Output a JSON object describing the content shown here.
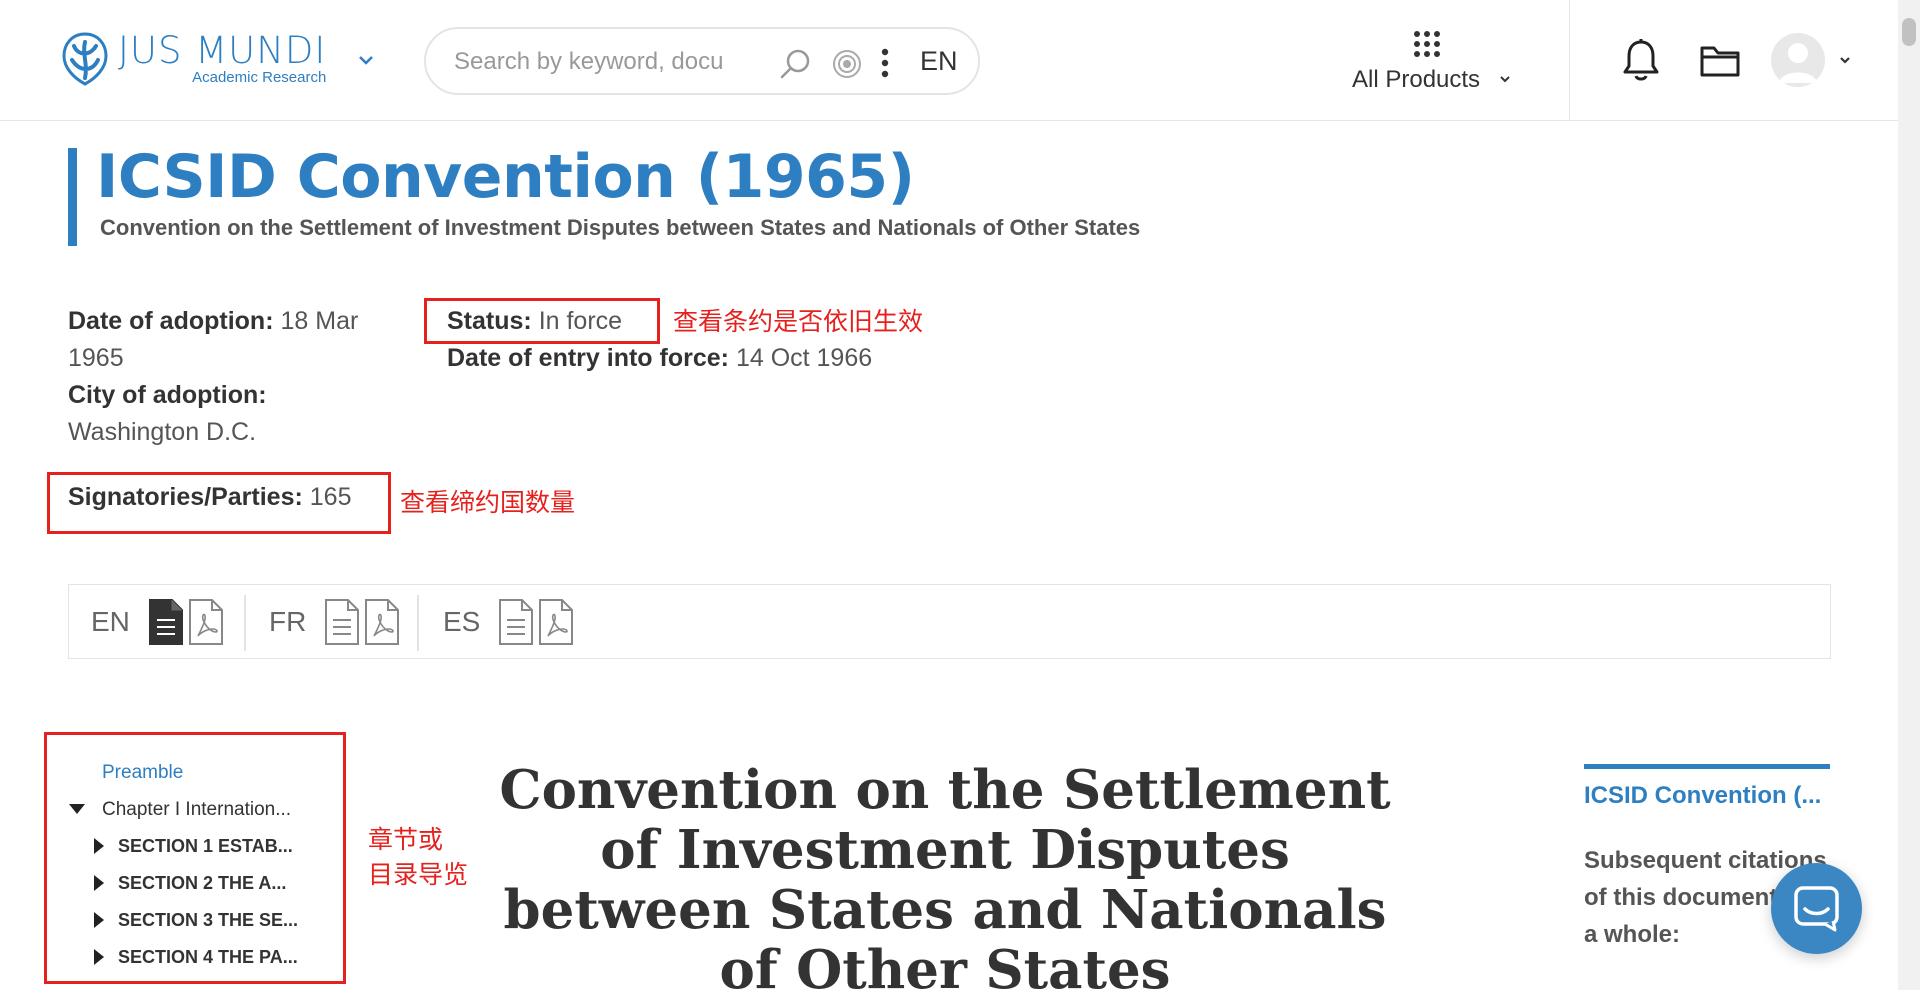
{
  "header": {
    "logo": {
      "name": "JUS MUNDI",
      "subtitle": "Academic Research"
    },
    "search": {
      "placeholder": "Search by keyword, docu",
      "language": "EN"
    },
    "products_label": "All Products"
  },
  "page": {
    "title": "ICSID Convention (1965)",
    "subtitle": "Convention on the Settlement of Investment Disputes between States and Nationals of Other States"
  },
  "metadata": {
    "date_of_adoption": {
      "label": "Date of adoption:",
      "value": "18 Mar 1965"
    },
    "city_of_adoption": {
      "label": "City of adoption:",
      "value": "Washington D.C."
    },
    "status": {
      "label": "Status:",
      "value": "In force"
    },
    "date_of_entry": {
      "label": "Date of entry into force:",
      "value": "14 Oct 1966"
    },
    "signatories": {
      "label": "Signatories/Parties:",
      "value": "165"
    }
  },
  "annotations": {
    "status_note": "查看条约是否依旧生效",
    "parties_note": "查看缔约国数量",
    "toc_note_line1": "章节或",
    "toc_note_line2": "目录导览"
  },
  "documents": [
    {
      "lang": "EN",
      "active": true
    },
    {
      "lang": "FR",
      "active": false
    },
    {
      "lang": "ES",
      "active": false
    }
  ],
  "toc": {
    "preamble": "Preamble",
    "chapter1": "Chapter I Internation...",
    "sections": [
      "SECTION 1 ESTAB...",
      "SECTION 2 THE A...",
      "SECTION 3 THE SE...",
      "SECTION 4 THE PA..."
    ]
  },
  "document_heading": "Convention on the Settlement of Investment Disputes between States and Nationals of Other States",
  "side_panel": {
    "title": "ICSID Convention (...",
    "text": "Subsequent citations of this document as a whole:"
  },
  "colors": {
    "brand_blue": "#2e7fc1",
    "annotation_red": "#e5211d",
    "chat_blue": "#3a87c4"
  }
}
